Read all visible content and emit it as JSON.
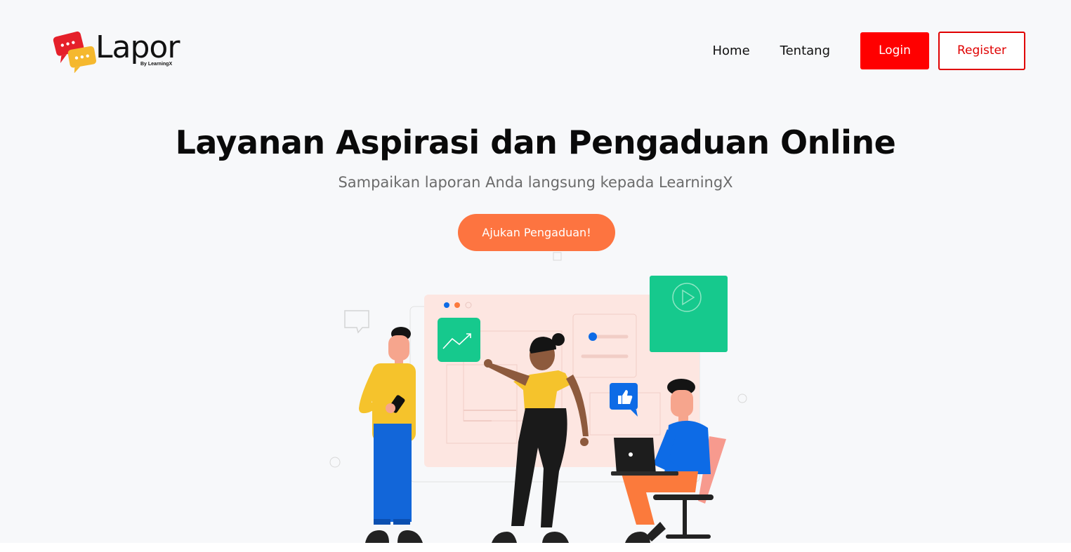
{
  "brand": {
    "name": "Lapor",
    "tagline": "By LearningX",
    "colors": {
      "primary": "#ff0000",
      "accent": "#fd7440",
      "yellow": "#f5b82e"
    }
  },
  "nav": {
    "links": [
      {
        "label": "Home"
      },
      {
        "label": "Tentang"
      }
    ],
    "login_label": "Login",
    "register_label": "Register"
  },
  "hero": {
    "title": "Layanan Aspirasi dan Pengaduan Online",
    "subtitle": "Sampaikan laporan Anda langsung kepada LearningX",
    "cta_label": "Ajukan Pengaduan!"
  },
  "illustration": {
    "icons": [
      "chart-trend-icon",
      "play-icon",
      "thumbs-up-icon",
      "chat-bubble-icon",
      "phone-icon",
      "laptop-icon"
    ],
    "colors": {
      "panel": "#fde6e1",
      "green": "#16c98d",
      "blue": "#0d6be6",
      "shirt_yellow": "#f5c32c",
      "pants_blue": "#1266d9",
      "chair": "#f79a8e",
      "pants_orange": "#fb7a3c"
    }
  }
}
